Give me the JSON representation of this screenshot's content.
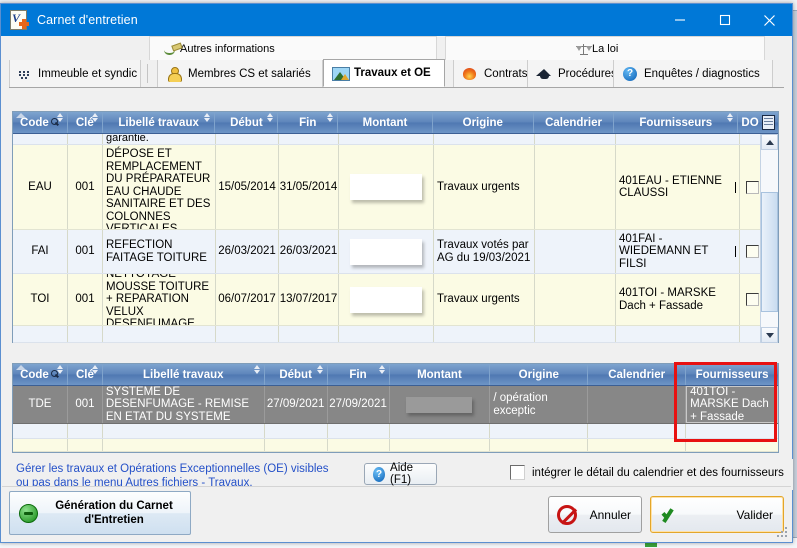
{
  "window": {
    "title": "Carnet d'entretien",
    "icon": "document-plus-icon",
    "minimize": "–",
    "maximize": "□",
    "close": "×"
  },
  "tabs": {
    "upper": [
      {
        "label": "Autres informations",
        "icon": "pen-icon"
      },
      {
        "label": "La loi",
        "icon": "scales-icon"
      }
    ],
    "lower": [
      {
        "label": "Immeuble et syndic",
        "icon": "grid-dots-icon",
        "active": false
      },
      {
        "label": "Membres CS et salariés",
        "icon": "person-icon",
        "active": false
      },
      {
        "label": "Travaux et OE",
        "icon": "mountain-icon",
        "active": true
      },
      {
        "label": "Contrats",
        "icon": "fire-icon",
        "active": false
      },
      {
        "label": "Procédures",
        "icon": "graduation-cap-icon",
        "active": false
      },
      {
        "label": "Enquêtes / diagnostics",
        "icon": "question-circle-icon",
        "active": false
      }
    ]
  },
  "grid_top": {
    "columns": [
      {
        "label": "Code",
        "sortable": true,
        "has_search": true,
        "sorted_asc": true
      },
      {
        "label": "Clé",
        "sortable": true
      },
      {
        "label": "Libellé travaux",
        "sortable": true
      },
      {
        "label": "Début",
        "sortable": true
      },
      {
        "label": "Fin",
        "sortable": true
      },
      {
        "label": "Montant",
        "sortable": false
      },
      {
        "label": "Origine",
        "sortable": false
      },
      {
        "label": "Calendrier",
        "sortable": false
      },
      {
        "label": "Fournisseurs",
        "sortable": true
      },
      {
        "label": "DO",
        "sortable": false,
        "has_column_picker": true
      }
    ],
    "partial_row_text": "garantie.",
    "rows": [
      {
        "code": "EAU",
        "cle": "001",
        "libelle": "DÉPOSE ET REMPLACEMENT DU PRÉPARATEUR EAU CHAUDE SANITAIRE ET DES COLONNES VERTICALES",
        "debut": "15/05/2014",
        "fin": "31/05/2014",
        "montant": "",
        "montant_redacted": true,
        "origine": "Travaux urgents",
        "calendrier": "",
        "fournisseurs": "401EAU - ETIENNE CLAUSSI",
        "fournisseurs_caret": true,
        "do_checked": false
      },
      {
        "code": "FAI",
        "cle": "001",
        "libelle": "REFECTION FAITAGE TOITURE",
        "debut": "26/03/2021",
        "fin": "26/03/2021",
        "montant": "",
        "montant_redacted": true,
        "origine": "Travaux votés par AG du 19/03/2021",
        "calendrier": "",
        "fournisseurs": "401FAI - WIEDEMANN ET FILSI",
        "fournisseurs_caret": true,
        "do_checked": false
      },
      {
        "code": "TOI",
        "cle": "001",
        "libelle": "NETTOYAGE MOUSSE TOITURE + REPARATION VELUX DESENFUMAGE",
        "debut": "06/07/2017",
        "fin": "13/07/2017",
        "montant": "",
        "montant_redacted": true,
        "origine": "Travaux urgents",
        "calendrier": "",
        "fournisseurs": "401TOI - MARSKE Dach + Fassade",
        "fournisseurs_caret": false,
        "do_checked": false
      }
    ]
  },
  "grid_bottom": {
    "columns": [
      {
        "label": "Code",
        "sortable": true,
        "has_search": true,
        "sorted_asc": true
      },
      {
        "label": "Clé",
        "sortable": true
      },
      {
        "label": "Libellé travaux",
        "sortable": true
      },
      {
        "label": "Début",
        "sortable": true
      },
      {
        "label": "Fin",
        "sortable": true
      },
      {
        "label": "Montant",
        "sortable": true
      },
      {
        "label": "Origine",
        "sortable": false
      },
      {
        "label": "Calendrier",
        "sortable": false
      },
      {
        "label": "Fournisseurs",
        "sortable": false,
        "highlighted": true
      }
    ],
    "rows": [
      {
        "code": "TDE",
        "cle": "001",
        "libelle": "SYSTEME DE DESENFUMAGE - REMISE EN ETAT DU SYSTEME",
        "debut": "27/09/2021",
        "fin": "27/09/2021",
        "montant": "",
        "montant_redacted": true,
        "origine": "/ opération exceptic",
        "calendrier": "",
        "fournisseurs": "401TOI - MARSKE Dach + Fassade",
        "fournisseurs_caret": true,
        "selected": true
      }
    ]
  },
  "footer": {
    "info_line1": "Gérer les travaux et Opérations Exceptionnelles (OE) visibles",
    "info_line2": "ou pas dans le menu Autres fichiers - Travaux.",
    "help_button": "Aide (F1)",
    "checkbox_label": "intégrer le détail du calendrier et des fournisseurs",
    "checkbox_checked": false,
    "generate_button_line1": "Génération du Carnet",
    "generate_button_line2": "d'Entretien",
    "cancel_button": "Annuler",
    "validate_button": "Valider"
  },
  "colors": {
    "title_bar": "#0078d7",
    "grid_header": "#5e85bb",
    "row_alt_a": "#fbfbe4",
    "row_alt_b": "#eef3fa",
    "selected_row": "#878787",
    "info_text": "#2450c8",
    "highlight_box": "#e81111"
  }
}
